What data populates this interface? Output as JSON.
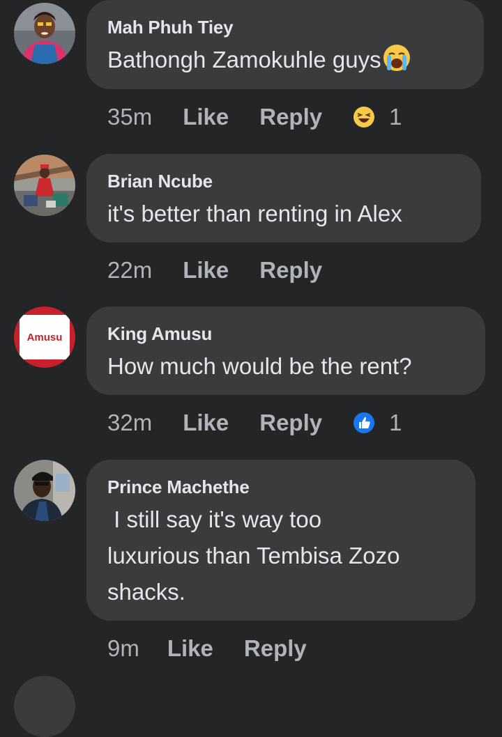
{
  "comments": [
    {
      "author": "Mah Phuh Tiey",
      "text": "Bathongh Zamokuhle guys",
      "text_emoji": "crying-face-emoji",
      "time": "35m",
      "like_label": "Like",
      "reply_label": "Reply",
      "reaction": {
        "icon": "laughing-face-icon",
        "count": "1"
      }
    },
    {
      "author": "Brian Ncube",
      "text": "it's better than renting in Alex",
      "time": "22m",
      "like_label": "Like",
      "reply_label": "Reply"
    },
    {
      "author": "King Amusu",
      "avatar_text": "Amusu",
      "text": "How much would be the rent?",
      "time": "32m",
      "like_label": "Like",
      "reply_label": "Reply",
      "reaction": {
        "icon": "like-thumb-icon",
        "count": "1"
      }
    },
    {
      "author": "Prince Machethe",
      "text_lines": [
        " I still say it's way too",
        "luxurious than Tembisa Zozo",
        "shacks."
      ],
      "time": "9m",
      "like_label": "Like",
      "reply_label": "Reply"
    }
  ],
  "colors": {
    "background": "#242526",
    "bubble": "#3a3b3c",
    "primary_text": "#e4e6eb",
    "secondary_text": "#b0b3b8",
    "like_blue": "#1877f2",
    "amusu_red": "#c8202a"
  }
}
